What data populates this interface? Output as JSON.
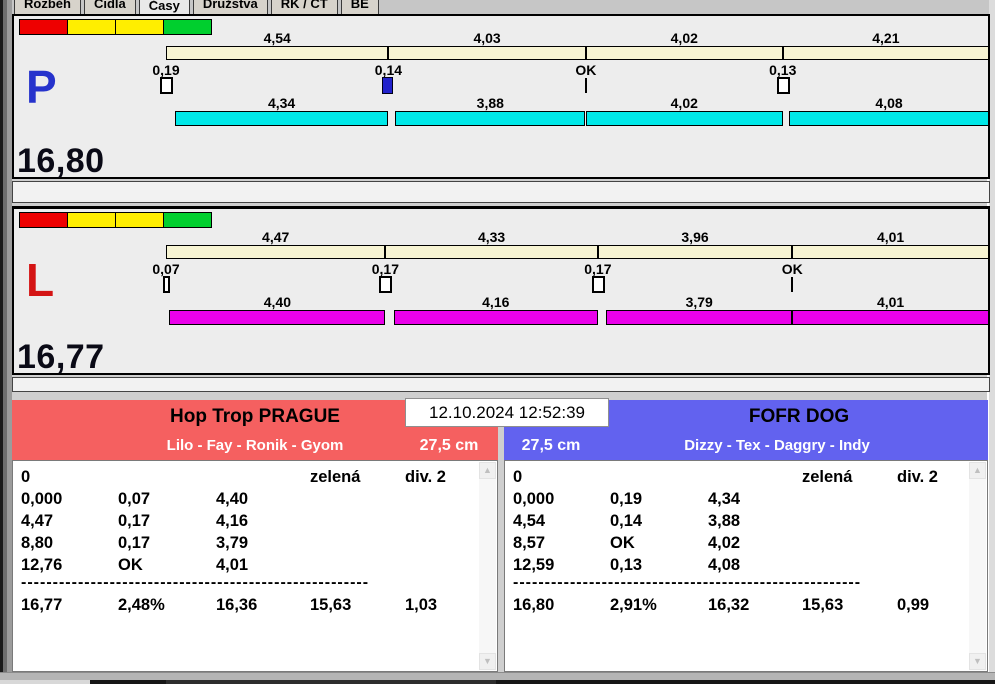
{
  "tabs": {
    "items": [
      {
        "label": "Rozběh",
        "selected": false
      },
      {
        "label": "Čidla",
        "selected": false
      },
      {
        "label": "Časy",
        "selected": true
      },
      {
        "label": "Družstva",
        "selected": false
      },
      {
        "label": "RK / ČT",
        "selected": false
      },
      {
        "label": "BĚ",
        "selected": false
      }
    ]
  },
  "timestamp": "12.10.2024 12:52:39",
  "run_panels": [
    {
      "id": "P",
      "lane_letter": "P",
      "lane_color": "#2633cc",
      "total": "16,80",
      "total_value": 16.8,
      "status_lights": [
        "#ee0000",
        "#ffee00",
        "#ffee00",
        "#00cf2e"
      ],
      "leg_bar_color": "#00e8e8",
      "split_labels": [
        "4,54",
        "4,03",
        "4,02",
        "4,21"
      ],
      "split_values": [
        4.54,
        4.03,
        4.02,
        4.21
      ],
      "change_labels": [
        "0,19",
        "0,14",
        "OK",
        "0,13"
      ],
      "change_values": [
        0.19,
        0.14,
        0,
        0.13
      ],
      "marker_types": [
        "box",
        "box-filled",
        "tick",
        "box"
      ],
      "leg_labels": [
        "4,34",
        "3,88",
        "4,02",
        "4,08"
      ],
      "leg_values": [
        4.34,
        3.88,
        4.02,
        4.08
      ]
    },
    {
      "id": "L",
      "lane_letter": "L",
      "lane_color": "#d41414",
      "total": "16,77",
      "total_value": 16.77,
      "status_lights": [
        "#ee0000",
        "#ffee00",
        "#ffee00",
        "#00cf2e"
      ],
      "leg_bar_color": "#ea00ea",
      "split_labels": [
        "4,47",
        "4,33",
        "3,96",
        "4,01"
      ],
      "split_values": [
        4.47,
        4.33,
        3.96,
        4.01
      ],
      "change_labels": [
        "0,07",
        "0,17",
        "0,17",
        "OK"
      ],
      "change_values": [
        0.07,
        0.17,
        0.17,
        0
      ],
      "marker_types": [
        "box-thin",
        "box",
        "box",
        "tick"
      ],
      "leg_labels": [
        "4,40",
        "4,16",
        "3,79",
        "4,01"
      ],
      "leg_values": [
        4.4,
        4.16,
        3.79,
        4.01
      ]
    }
  ],
  "teams": [
    {
      "name": "Hop Trop PRAGUE",
      "dogs": "Lilo - Fay - Ronik - Gyom",
      "height": "27,5 cm",
      "accent": "#f56060",
      "table": {
        "header": [
          "0",
          "",
          "",
          "zelená",
          "div. 2"
        ],
        "rows": [
          [
            "0,000",
            "0,07",
            "4,40"
          ],
          [
            "4,47",
            "0,17",
            "4,16"
          ],
          [
            "8,80",
            "0,17",
            "3,79"
          ],
          [
            "12,76",
            "OK",
            "4,01"
          ]
        ],
        "totals": [
          "16,77",
          "2,48%",
          "16,36",
          "15,63",
          "1,03"
        ]
      }
    },
    {
      "name": "FOFR DOG",
      "dogs": "Dizzy - Tex - Daggry - Indy",
      "height": "27,5 cm",
      "accent": "#6262ef",
      "table": {
        "header": [
          "0",
          "",
          "",
          "zelená",
          "div. 2"
        ],
        "rows": [
          [
            "0,000",
            "0,19",
            "4,34"
          ],
          [
            "4,54",
            "0,14",
            "3,88"
          ],
          [
            "8,57",
            "OK",
            "4,02"
          ],
          [
            "12,59",
            "0,13",
            "4,08"
          ]
        ],
        "totals": [
          "16,80",
          "2,91%",
          "16,32",
          "15,63",
          "0,99"
        ]
      }
    }
  ],
  "scrollbar": {
    "up_glyph": "▲",
    "down_glyph": "▼"
  }
}
